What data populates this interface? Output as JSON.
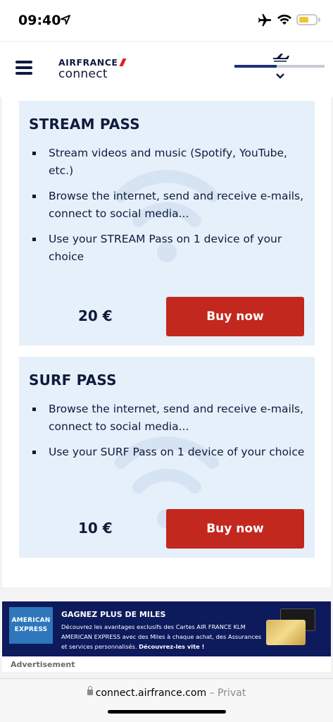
{
  "status_bar": {
    "time": "09:40",
    "icons": [
      "location-arrow-icon",
      "airplane-mode-icon",
      "wifi-icon",
      "battery-icon"
    ],
    "battery_color": "#f4c430"
  },
  "header": {
    "menu_icon": "hamburger-menu-icon",
    "brand_name": "AIRFRANCE",
    "brand_sub": "connect",
    "flight_progress": 0.47,
    "brand_color": "#0f1b3d",
    "accent_color": "#d9251c"
  },
  "passes": [
    {
      "title": "STREAM PASS",
      "features": [
        "Stream videos and music (Spotify, YouTube, etc.)",
        "Browse the internet, send and receive e-mails, connect to social media...",
        "Use your STREAM Pass on 1 device of your choice"
      ],
      "price": "20 €",
      "button_label": "Buy now"
    },
    {
      "title": "SURF PASS",
      "features": [
        "Browse the internet, send and receive e-mails, connect to social media...",
        "Use your SURF Pass on 1 device of your choice"
      ],
      "price": "10 €",
      "button_label": "Buy now"
    }
  ],
  "ad": {
    "logo_line1": "AMERICAN",
    "logo_line2": "EXPRESS",
    "title": "GAGNEZ PLUS DE MILES",
    "body": "Découvrez les avantages exclusifs des Cartes AIR FRANCE KLM AMERICAN EXPRESS avec des Miles à chaque achat, des Assurances et services personnalisés.",
    "cta": "Découvrez-les vite !",
    "label": "Advertisement"
  },
  "url_bar": {
    "url": "connect.airfrance.com",
    "separator": "–",
    "mode": "Privat"
  },
  "colors": {
    "pass_background": "#e6f0fa",
    "button_red": "#c3281e",
    "ad_background": "#0d1a5c"
  }
}
